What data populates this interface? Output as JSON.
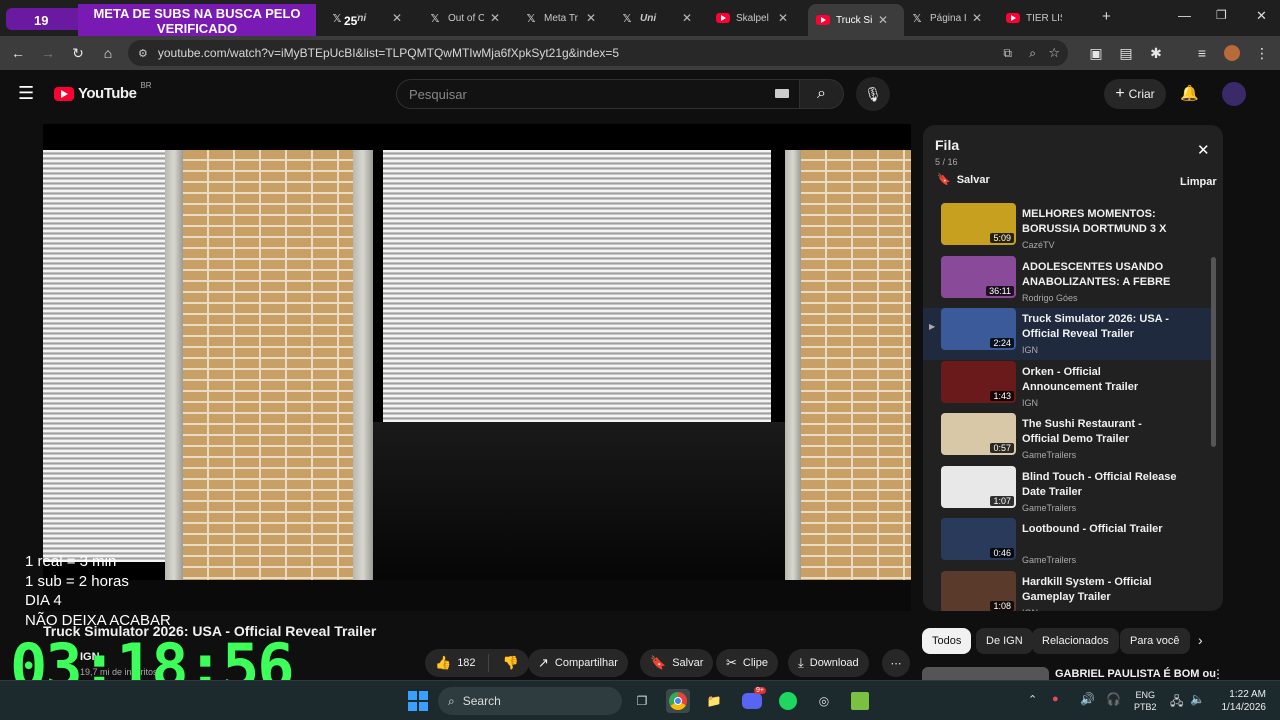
{
  "browser": {
    "left_badge": "19",
    "tabs": [
      {
        "title": "META DE SUBS NA BUSCA PELO VERIFICADO",
        "kind": "banner"
      },
      {
        "title": "Uni",
        "kind": "x",
        "badge": "25"
      },
      {
        "title": "Out of C",
        "kind": "x"
      },
      {
        "title": "Meta Tr",
        "kind": "x"
      },
      {
        "title": "Uni",
        "kind": "x"
      },
      {
        "title": "Skalpel",
        "kind": "yt"
      },
      {
        "title": "Truck Si",
        "kind": "yt",
        "active": true
      },
      {
        "title": "Página I",
        "kind": "x"
      },
      {
        "title": "TIER LIS",
        "kind": "yt"
      }
    ],
    "url": "youtube.com/watch?v=iMyBTEpUcBI&list=TLPQMTQwMTIwMja6fXpkSyt21g&index=5"
  },
  "youtube": {
    "logo": "YouTube",
    "region": "BR",
    "search_placeholder": "Pesquisar",
    "create_label": "Criar"
  },
  "overlay": {
    "lines": [
      "1 real = 3 min",
      "1 sub = 2 horas",
      "DIA 4",
      "NÃO DEIXA ACABAR"
    ],
    "timer": "03:18:56"
  },
  "video": {
    "title": "Truck Simulator 2026: USA - Official Reveal Trailer",
    "channel": "IGN",
    "subs": "19,7 mi de inscritos",
    "likes": "182",
    "actions": [
      "Compartilhar",
      "Salvar",
      "Clipe",
      "Download"
    ]
  },
  "queue": {
    "title": "Fila",
    "position": "5 / 16",
    "save_label": "Salvar",
    "clear_label": "Limpar",
    "items": [
      {
        "title": "MELHORES MOMENTOS: BORUSSIA DORTMUND 3 X 0...",
        "channel": "CazéTV",
        "duration": "5:09",
        "thumb_color": "#c8a020"
      },
      {
        "title": "ADOLESCENTES USANDO ANABOLIZANTES: A FEBRE D...",
        "channel": "Rodrigo Góes",
        "duration": "36:11",
        "thumb_color": "#8a4a9a"
      },
      {
        "title": "Truck Simulator 2026: USA - Official Reveal Trailer",
        "channel": "IGN",
        "duration": "2:24",
        "thumb_color": "#3a5a9a",
        "active": true
      },
      {
        "title": "Orken - Official Announcement Trailer",
        "channel": "IGN",
        "duration": "1:43",
        "thumb_color": "#6a1a1a"
      },
      {
        "title": "The Sushi Restaurant - Official Demo Trailer",
        "channel": "GameTrailers",
        "duration": "0:57",
        "thumb_color": "#d8c8a8"
      },
      {
        "title": "Blind Touch - Official Release Date Trailer",
        "channel": "GameTrailers",
        "duration": "1:07",
        "thumb_color": "#e8e8e8"
      },
      {
        "title": "Lootbound - Official Trailer",
        "channel": "GameTrailers",
        "duration": "0:46",
        "thumb_color": "#2a3a5a"
      },
      {
        "title": "Hardkill System - Official Gameplay Trailer",
        "channel": "IGN",
        "duration": "1:08",
        "thumb_color": "#5a3a2a"
      }
    ]
  },
  "chips": [
    "Todos",
    "De IGN",
    "Relacionados",
    "Para você"
  ],
  "recommended": {
    "title": "GABRIEL PAULISTA É BOM ou"
  },
  "taskbar": {
    "search_label": "Search",
    "lang": "ENG",
    "layout": "PTB2",
    "time": "1:22 AM",
    "date": "1/14/2026",
    "discord_badge": "9+"
  }
}
